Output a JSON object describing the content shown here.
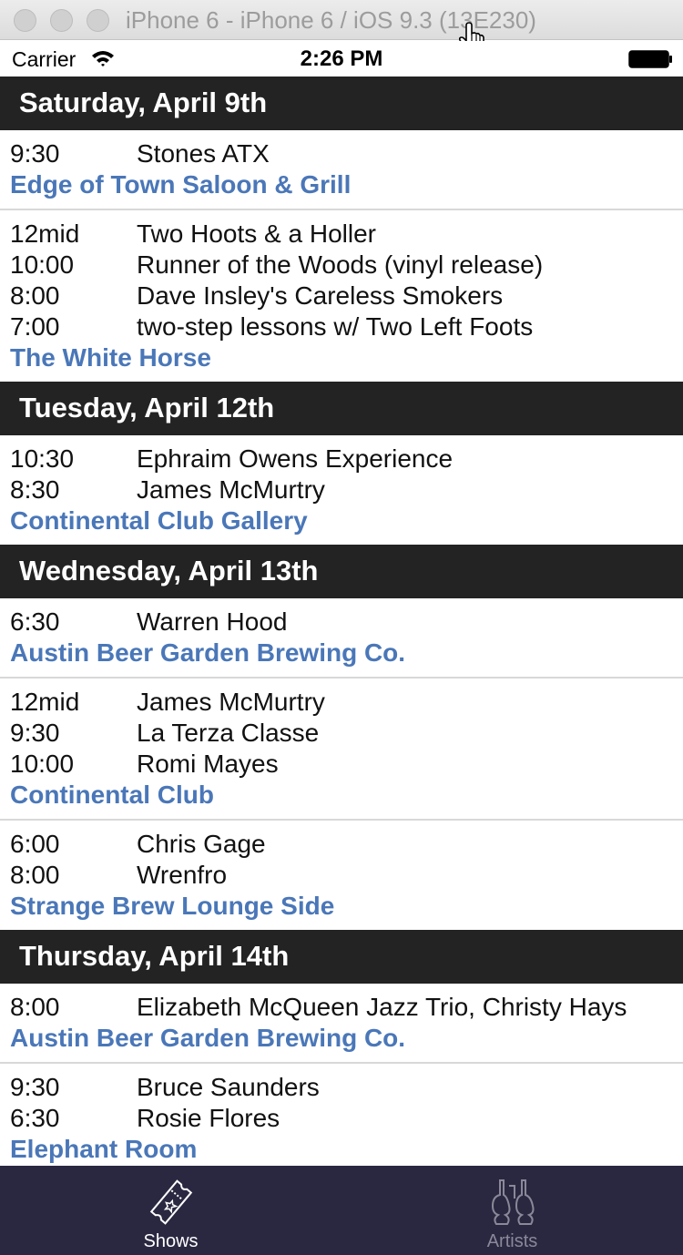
{
  "window": {
    "title": "iPhone 6 - iPhone 6 / iOS 9.3 (13E230)"
  },
  "status_bar": {
    "carrier": "Carrier",
    "time": "2:26 PM"
  },
  "days": [
    {
      "label": "Saturday, April 9th",
      "venues": [
        {
          "name": "Edge of Town Saloon & Grill",
          "shows": [
            {
              "time": "9:30",
              "artist": "Stones ATX"
            }
          ]
        },
        {
          "name": "The White Horse",
          "shows": [
            {
              "time": "12mid",
              "artist": "Two Hoots & a Holler"
            },
            {
              "time": "10:00",
              "artist": "Runner of the Woods (vinyl release)"
            },
            {
              "time": "8:00",
              "artist": "Dave Insley's Careless Smokers"
            },
            {
              "time": "7:00",
              "artist": "two-step lessons w/ Two Left Foots"
            }
          ]
        }
      ]
    },
    {
      "label": "Tuesday, April 12th",
      "venues": [
        {
          "name": "Continental Club Gallery",
          "shows": [
            {
              "time": "10:30",
              "artist": "Ephraim Owens Experience"
            },
            {
              "time": "8:30",
              "artist": "James McMurtry"
            }
          ]
        }
      ]
    },
    {
      "label": "Wednesday, April 13th",
      "venues": [
        {
          "name": "Austin Beer Garden Brewing Co.",
          "shows": [
            {
              "time": "6:30",
              "artist": "Warren Hood"
            }
          ]
        },
        {
          "name": "Continental Club",
          "shows": [
            {
              "time": "12mid",
              "artist": "James McMurtry"
            },
            {
              "time": "9:30",
              "artist": "La Terza Classe"
            },
            {
              "time": "10:00",
              "artist": "Romi Mayes"
            }
          ]
        },
        {
          "name": "Strange Brew Lounge Side",
          "shows": [
            {
              "time": "6:00",
              "artist": "Chris Gage"
            },
            {
              "time": "8:00",
              "artist": "Wrenfro"
            }
          ]
        }
      ]
    },
    {
      "label": "Thursday, April 14th",
      "venues": [
        {
          "name": "Austin Beer Garden Brewing Co.",
          "shows": [
            {
              "time": "8:00",
              "artist": "Elizabeth McQueen Jazz Trio, Christy Hays"
            }
          ]
        },
        {
          "name": "Elephant Room",
          "shows": [
            {
              "time": "9:30",
              "artist": "Bruce Saunders"
            },
            {
              "time": "6:30",
              "artist": "Rosie Flores"
            }
          ]
        }
      ]
    }
  ],
  "tab_bar": {
    "tabs": [
      {
        "label": "Shows",
        "icon": "ticket-icon",
        "selected": true
      },
      {
        "label": "Artists",
        "icon": "guitars-icon",
        "selected": false
      }
    ]
  },
  "colors": {
    "venue_link": "#4a77b8",
    "day_header_bg": "#232323",
    "tab_bar_bg": "#2a2841"
  }
}
